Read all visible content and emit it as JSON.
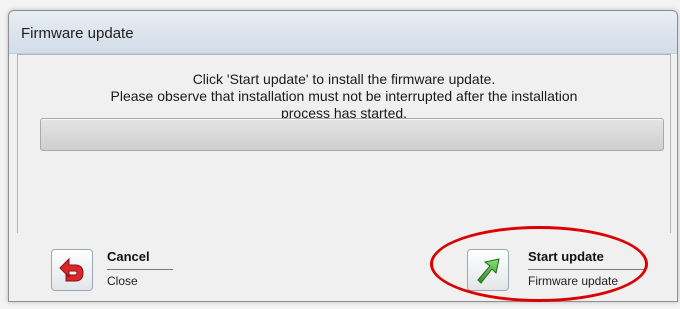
{
  "window": {
    "title": "Firmware update"
  },
  "instructions": {
    "line1": "Click 'Start update' to install the firmware update.",
    "line2": "Please observe that installation must not be interrupted after the installation",
    "line3": "process has started."
  },
  "progress": {
    "value": 0
  },
  "buttons": {
    "cancel": {
      "label": "Cancel",
      "sublabel": "Close",
      "icon": "undo-arrow-icon",
      "icon_color": "#d9262a"
    },
    "start": {
      "label": "Start update",
      "sublabel": "Firmware update",
      "icon": "arrow-up-right-icon",
      "icon_color": "#3fa834"
    }
  },
  "highlight": {
    "color": "#dd0000",
    "target": "start-update-button"
  }
}
